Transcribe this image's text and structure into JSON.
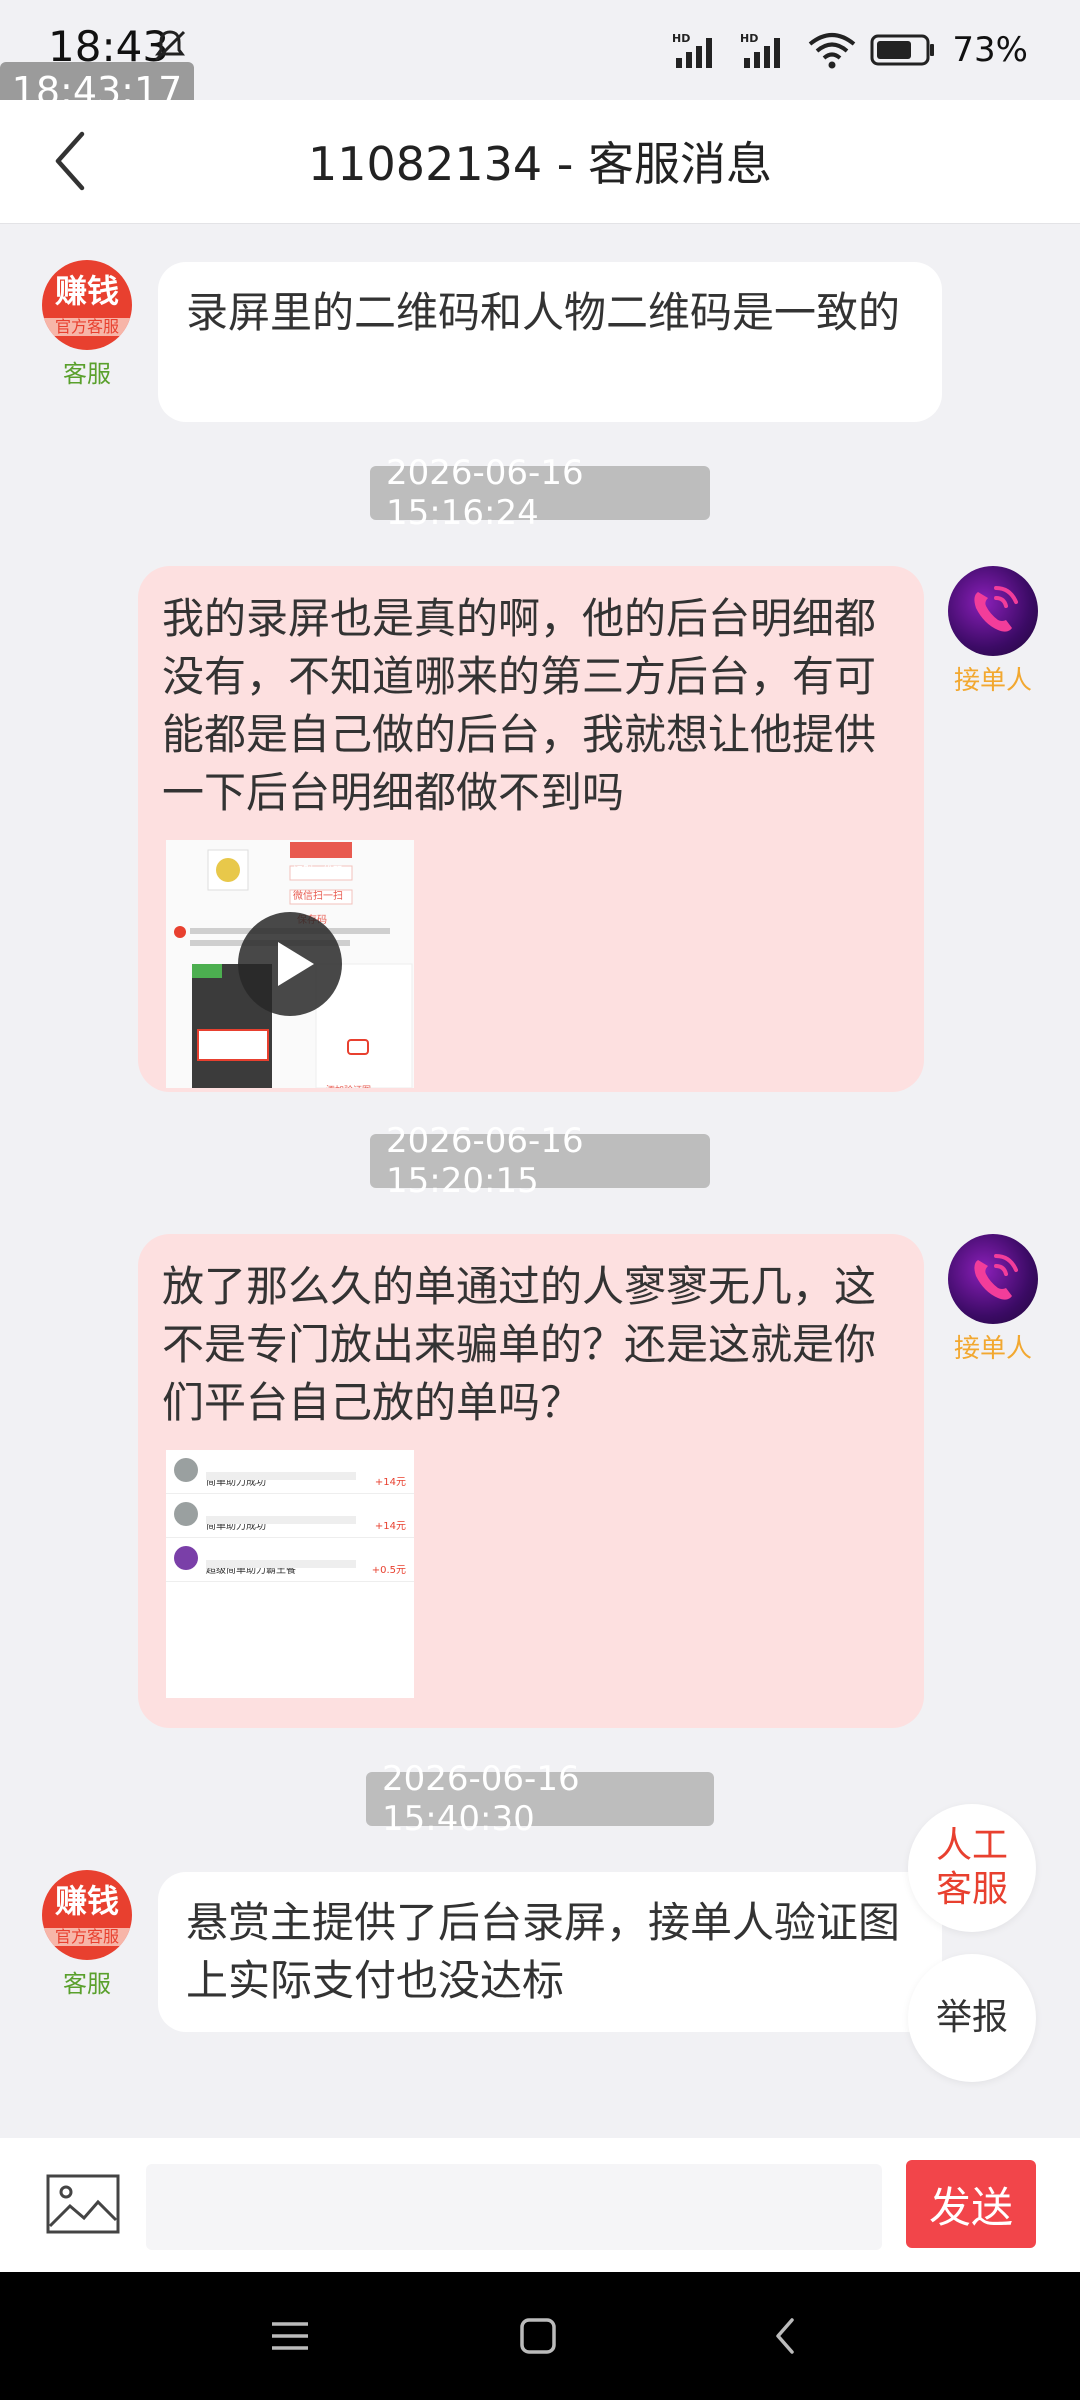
{
  "status_bar": {
    "time": "18:43",
    "overlay_time": "18:43:17",
    "battery_percent": "73%",
    "icons": [
      "bell-muted-icon",
      "hd-signal-icon",
      "hd-signal-icon",
      "wifi-icon",
      "battery-icon"
    ]
  },
  "header": {
    "title": "11082134 - 客服消息"
  },
  "labels": {
    "customer_service": "客服",
    "taker": "接单人",
    "avatar_text": "赚钱",
    "avatar_subtext": "官方客服"
  },
  "messages": [
    {
      "sender": "customer_service",
      "text": "录屏里的二维码和人物二维码是一致的"
    },
    {
      "timestamp": "2026-06-16 15:16:24"
    },
    {
      "sender": "taker",
      "text": "我的录屏也是真的啊，他的后台明细都没有，不知道哪来的第三方后台，有可能都是自己做的后台，我就想让他提供一下后台明细都做不到吗",
      "attachment": "video"
    },
    {
      "timestamp": "2026-06-16 15:20:15"
    },
    {
      "sender": "taker",
      "text": "放了那么久的单通过的人寥寥无几，这不是专门放出来骗单的？还是这就是你们平台自己放的单吗？",
      "attachment": "image"
    },
    {
      "timestamp": "2026-06-16 15:40:30"
    },
    {
      "sender": "customer_service",
      "text": "悬赏主提供了后台录屏，接单人验证图上实际支付也没达标"
    }
  ],
  "thumb1": {
    "btn_identify": "识别二维码",
    "btn_scan": "微信扫一扫",
    "btn_save": "保存码",
    "add_label": "添加验证图"
  },
  "thumb2": {
    "rows": [
      {
        "title": "简单助力成功",
        "amount": "+14元"
      },
      {
        "title": "简单助力成功",
        "amount": "+14元"
      },
      {
        "title": "超级简单助力霸王餐",
        "amount": "+0.5元"
      }
    ]
  },
  "float_buttons": {
    "human_service": "人工客服",
    "report": "举报"
  },
  "input_bar": {
    "placeholder": "",
    "send_label": "发送"
  },
  "colors": {
    "accent_red": "#f2454a",
    "bubble_pink": "#fde0e0",
    "label_green": "#5aa02c",
    "label_orange": "#f2a830"
  }
}
